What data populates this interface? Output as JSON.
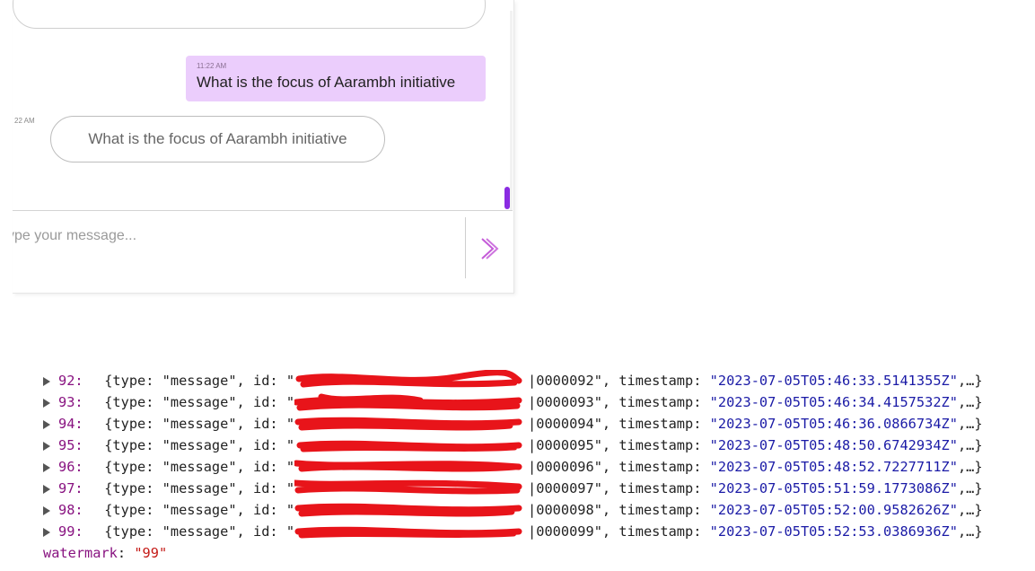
{
  "chat": {
    "user_message": {
      "time": "11:22 AM",
      "text": "What is the focus of Aarambh initiative"
    },
    "bot_time": "22 AM",
    "suggestion": "What is the focus of Aarambh initiative",
    "input_placeholder": "ype your message...",
    "send_icon": "chevron-right-icon",
    "accent_color": "#8a2be2",
    "bubble_color": "#ebcdfc"
  },
  "console": {
    "rows": [
      {
        "index": "92:",
        "prefix": " {type: \"message\", id: \"",
        "id_suffix": "|0000092\"",
        "timestamp_label": ", timestamp: ",
        "timestamp": "\"2023-07-05T05:46:33.5141355Z\"",
        "tail": ",…}"
      },
      {
        "index": "93:",
        "prefix": " {type: \"message\", id: \"",
        "id_suffix": "|0000093\"",
        "timestamp_label": ", timestamp: ",
        "timestamp": "\"2023-07-05T05:46:34.4157532Z\"",
        "tail": ",…}"
      },
      {
        "index": "94:",
        "prefix": " {type: \"message\", id: \"",
        "id_suffix": "|0000094\"",
        "timestamp_label": ", timestamp: ",
        "timestamp": "\"2023-07-05T05:46:36.0866734Z\"",
        "tail": ",…}"
      },
      {
        "index": "95:",
        "prefix": " {type: \"message\", id: \"",
        "id_suffix": "|0000095\"",
        "timestamp_label": ", timestamp: ",
        "timestamp": "\"2023-07-05T05:48:50.6742934Z\"",
        "tail": ",…}"
      },
      {
        "index": "96:",
        "prefix": " {type: \"message\", id: \"",
        "id_suffix": "|0000096\"",
        "timestamp_label": ", timestamp: ",
        "timestamp": "\"2023-07-05T05:48:52.7227711Z\"",
        "tail": ",…}"
      },
      {
        "index": "97:",
        "prefix": " {type: \"message\", id: \"",
        "id_suffix": "|0000097\"",
        "timestamp_label": ", timestamp: ",
        "timestamp": "\"2023-07-05T05:51:59.1773086Z\"",
        "tail": ",…}"
      },
      {
        "index": "98:",
        "prefix": " {type: \"message\", id: \"",
        "id_suffix": "|0000098\"",
        "timestamp_label": ", timestamp: ",
        "timestamp": "\"2023-07-05T05:52:00.9582626Z\"",
        "tail": ",…}"
      },
      {
        "index": "99:",
        "prefix": " {type: \"message\", id: \"",
        "id_suffix": "|0000099\"",
        "timestamp_label": ", timestamp: ",
        "timestamp": "\"2023-07-05T05:52:53.0386936Z\"",
        "tail": ",…}"
      }
    ],
    "watermark_key": "watermark",
    "watermark_value": "\"99\"",
    "redaction_color": "#e8141a"
  }
}
